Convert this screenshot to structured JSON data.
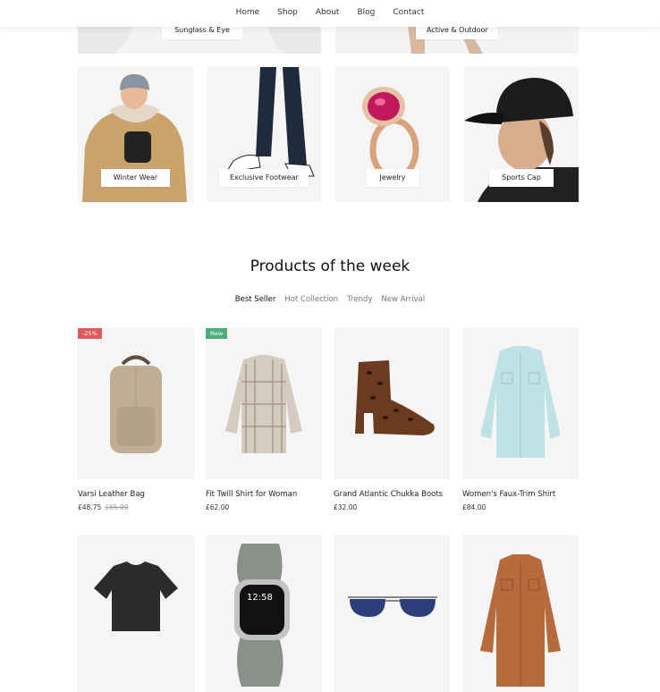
{
  "nav": {
    "items": [
      "Home",
      "Shop",
      "About",
      "Blog",
      "Contact"
    ]
  },
  "categories_top": [
    {
      "label": "Sunglass & Eye"
    },
    {
      "label": "Active & Outdoor"
    }
  ],
  "categories": [
    {
      "label": "Winter Wear"
    },
    {
      "label": "Exclusive Footwear"
    },
    {
      "label": "Jewelry"
    },
    {
      "label": "Sports Cap"
    }
  ],
  "section": {
    "title": "Products of the week",
    "filters": [
      "Best Seller",
      "Hot Collection",
      "Trendy",
      "New Arrival"
    ],
    "active_filter": "Best Seller"
  },
  "products": [
    {
      "name": "Varsi Leather Bag",
      "price": "£48.75",
      "old_price": "£65.00",
      "badge": "-25%"
    },
    {
      "name": "Fit Twill Shirt for Woman",
      "price": "£62.00",
      "badge": "New"
    },
    {
      "name": "Grand Atlantic Chukka Boots",
      "price": "£32.00"
    },
    {
      "name": "Women's Faux-Trim Shirt",
      "price": "£84.00"
    }
  ],
  "watch_display": {
    "time": "12:58"
  },
  "colors": {
    "sale_badge": "#e05a5a",
    "new_badge": "#4caf7a",
    "card_bg": "#f5f5f5"
  }
}
